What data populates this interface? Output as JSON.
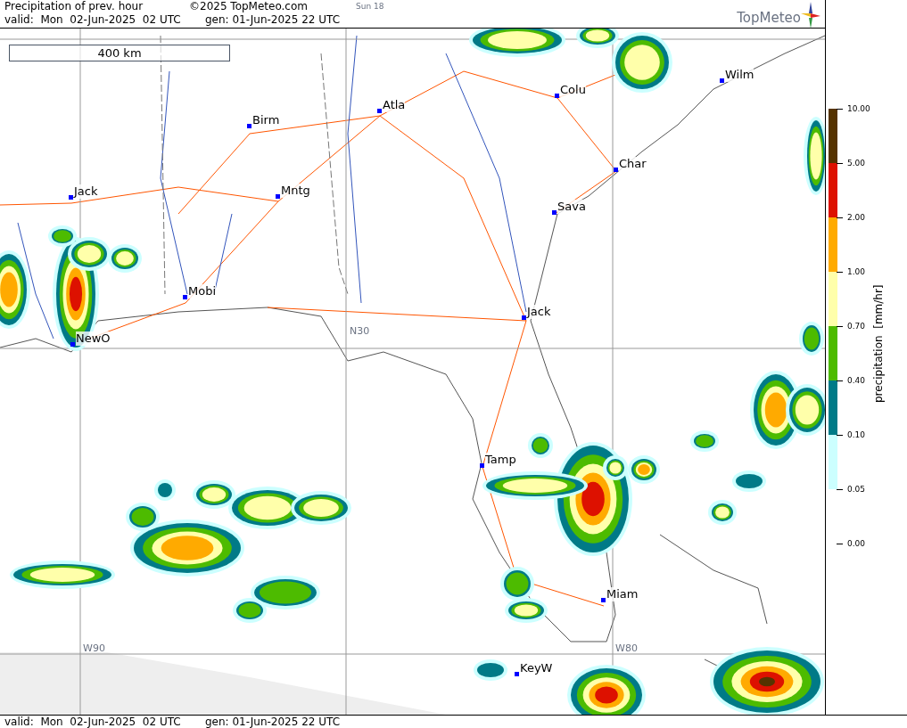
{
  "header": {
    "title": "Precipitation of prev. hour",
    "copyright": "©2025 TopMeteo.com",
    "run_label": "Sun 18",
    "valid": "valid:  Mon  02-Jun-2025  02 UTC",
    "generated": "gen: 01-Jun-2025 22 UTC"
  },
  "logo": {
    "text": "TopMeteo"
  },
  "map": {
    "scale_label": "400 km",
    "grid_labels": [
      "N30",
      "W90",
      "W80"
    ],
    "cities": [
      {
        "name": "Wilm"
      },
      {
        "name": "Colu"
      },
      {
        "name": "Atla"
      },
      {
        "name": "Birm"
      },
      {
        "name": "Char"
      },
      {
        "name": "Jack"
      },
      {
        "name": "Mntg"
      },
      {
        "name": "Sava"
      },
      {
        "name": "Mobi"
      },
      {
        "name": "Jack"
      },
      {
        "name": "NewO"
      },
      {
        "name": "Tamp"
      },
      {
        "name": "Miam"
      },
      {
        "name": "KeyW"
      }
    ]
  },
  "legend": {
    "title": "precipitation  [mm/hr]",
    "ticks": [
      "10.00",
      "5.00",
      "2.00",
      "1.00",
      "0.70",
      "0.40",
      "0.10",
      "0.05",
      "0.00"
    ],
    "bands": [
      {
        "color": "#553300"
      },
      {
        "color": "#dd1100"
      },
      {
        "color": "#ffaa00"
      },
      {
        "color": "#ffffaa"
      },
      {
        "color": "#4dbb00"
      },
      {
        "color": "#007a87"
      },
      {
        "color": "#ccffff"
      }
    ]
  },
  "footer": {
    "valid": "valid:  Mon  02-Jun-2025  02 UTC",
    "generated": "gen: 01-Jun-2025 22 UTC"
  }
}
